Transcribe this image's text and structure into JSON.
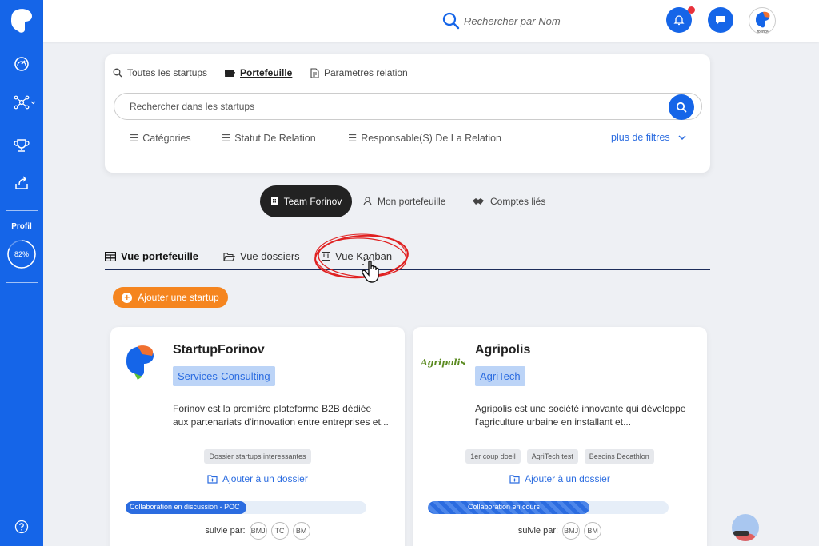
{
  "sidebar": {
    "items": [
      {
        "icon": "dashboard-gauge-icon"
      },
      {
        "icon": "network-icon"
      },
      {
        "icon": "trophy-icon"
      },
      {
        "icon": "share-upload-icon"
      }
    ],
    "profil_label": "Profil",
    "profile_progress": "82%",
    "profile_progress_value": 0.82,
    "help_icon": "help-icon"
  },
  "topbar": {
    "search_placeholder": "Rechercher par Nom",
    "notification_icon": "bell-icon",
    "messages_icon": "chat-icon",
    "avatar_caption": "forinov"
  },
  "filter_card": {
    "tabs": [
      {
        "label": "Toutes les startups",
        "icon": "search-icon"
      },
      {
        "label": "Portefeuille",
        "icon": "folder-open-icon",
        "active": true
      },
      {
        "label": "Parametres relation",
        "icon": "document-icon"
      }
    ],
    "search_placeholder": "Rechercher dans les startups",
    "filters": [
      "Catégories",
      "Statut De Relation",
      "Responsable(S) De La Relation"
    ],
    "more_filters": "plus de filtres"
  },
  "scope_toggle": {
    "options": [
      "Team Forinov",
      "Mon portefeuille",
      "Comptes liés"
    ],
    "active": "Team Forinov"
  },
  "view_tabs": {
    "tabs": [
      "Vue portefeuille",
      "Vue dossiers",
      "Vue Kanban"
    ],
    "active": "Vue portefeuille"
  },
  "add_startup_label": "Ajouter une startup",
  "startups": [
    {
      "name": "StartupForinov",
      "category": "Services-Consulting",
      "description": "Forinov est la première plateforme B2B dédiée aux partenariats d'innovation entre entreprises et...",
      "tags": [
        "Dossier startups interessantes"
      ],
      "add_folder": "Ajouter à un dossier",
      "status": "Collaboration en discussion - POC",
      "status_progress": 0.5,
      "followers_label": "suivie par:",
      "followers": [
        "BMJ",
        "TC",
        "BM"
      ]
    },
    {
      "name": "Agripolis",
      "logo_text": "Agripolis",
      "category": "AgriTech",
      "description": "Agripolis est une société innovante qui développe l'agriculture urbaine en installant et...",
      "tags": [
        "1er coup doeil",
        "AgriTech test",
        "Besoins Decathlon"
      ],
      "add_folder": "Ajouter à un dossier",
      "status": "Collaboration en cours",
      "status_progress": 0.67,
      "followers_label": "suivie par:",
      "followers": [
        "BMJ",
        "BM"
      ]
    }
  ],
  "colors": {
    "primary": "#1565e8",
    "accent_orange": "#f5851f",
    "category_bg": "#bcd4f7",
    "dark_toggle": "#222222",
    "highlight_red": "#e02020"
  }
}
